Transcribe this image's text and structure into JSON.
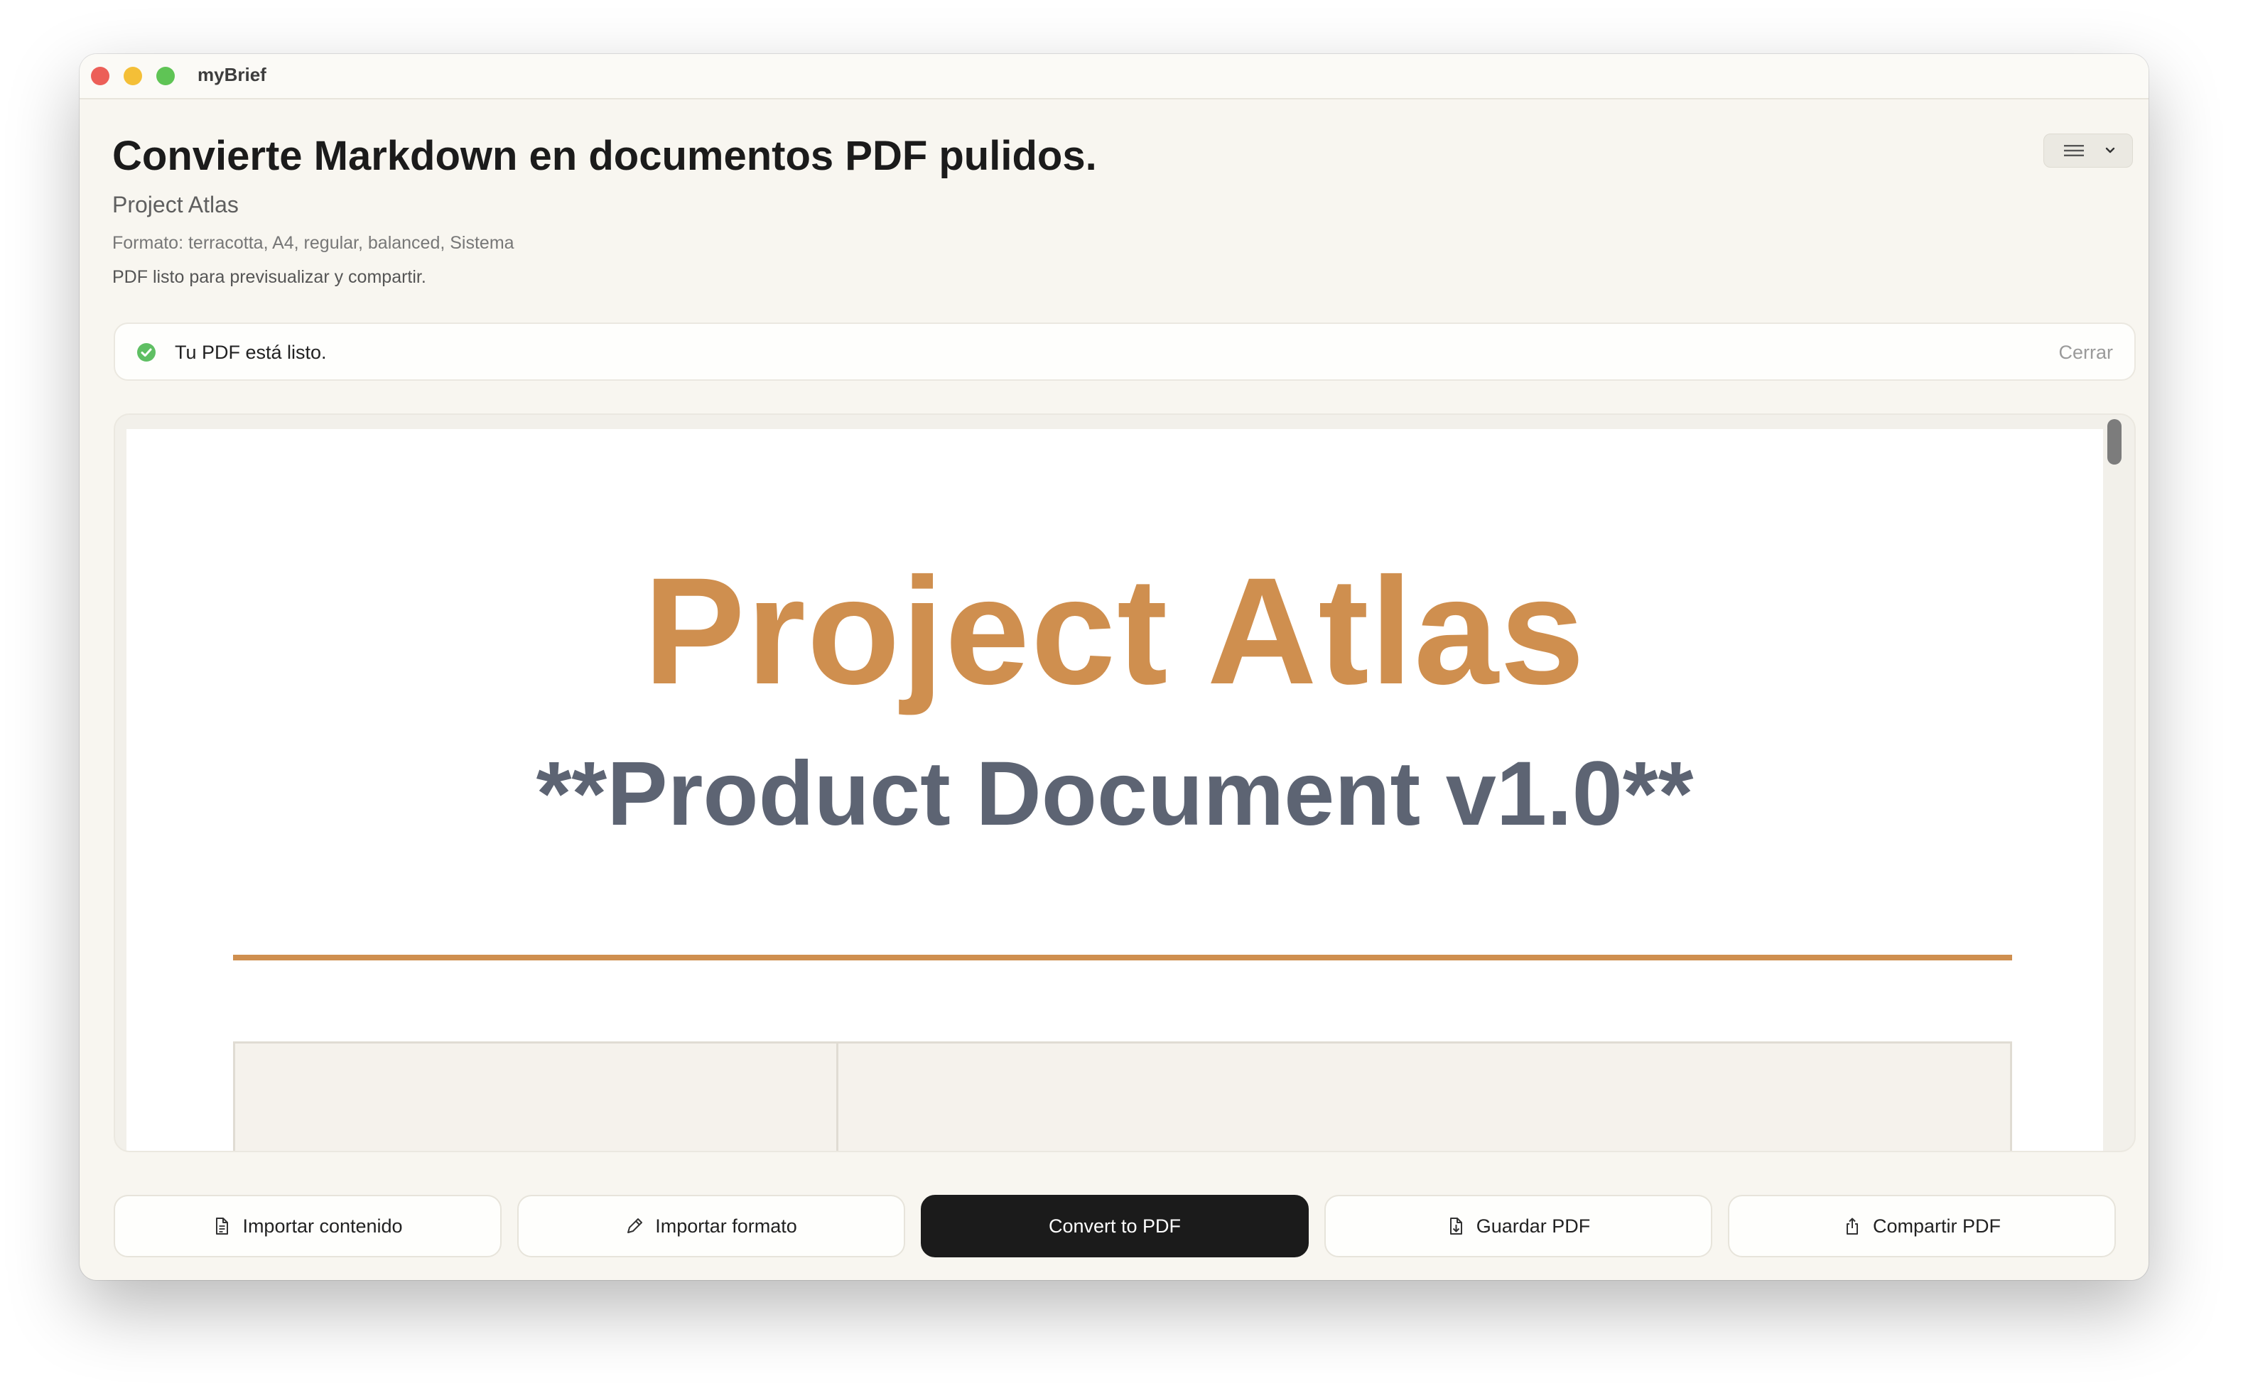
{
  "window": {
    "app_name": "myBrief"
  },
  "header": {
    "title": "Convierte Markdown en documentos PDF pulidos.",
    "project_name": "Project Atlas",
    "format_line": "Formato: terracotta, A4, regular, balanced, Sistema",
    "status_line": "PDF listo para previsualizar y compartir."
  },
  "banner": {
    "message": "Tu PDF está listo.",
    "close_label": "Cerrar",
    "status_color": "#5fbf63"
  },
  "preview": {
    "doc_title": "Project Atlas",
    "doc_subtitle": "**Product Document v1.0**",
    "accent_color": "#cf8f4f"
  },
  "toolbar": {
    "import_content_label": "Importar contenido",
    "import_format_label": "Importar formato",
    "convert_label": "Convert to PDF",
    "save_label": "Guardar PDF",
    "share_label": "Compartir PDF"
  },
  "icons": {
    "window_controls": [
      "close-icon",
      "minimize-icon",
      "zoom-icon"
    ],
    "menu": "list-icon",
    "menu_chevron": "chevron-down-icon",
    "banner": "checkmark-circle-icon",
    "import_content": "document-icon",
    "import_format": "pencil-icon",
    "save": "download-document-icon",
    "share": "share-icon"
  }
}
